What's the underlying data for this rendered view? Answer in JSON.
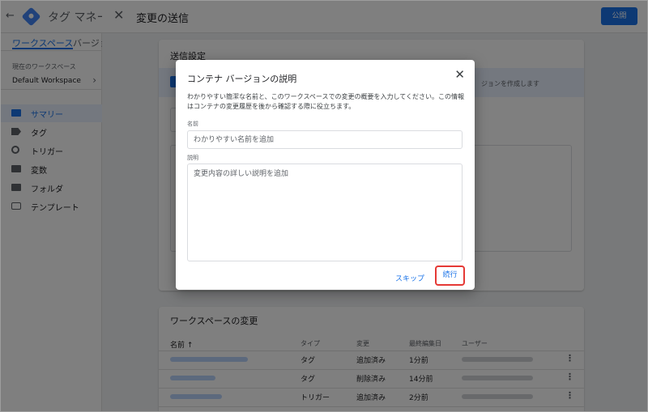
{
  "app": {
    "back_icon": "back-arrow-icon",
    "title": "タグ マネー"
  },
  "left_nav": {
    "tabs": [
      {
        "label": "ワークスペース",
        "active": true
      },
      {
        "label": "バージョ",
        "active": false
      }
    ],
    "workspace_label": "現在のワークスペース",
    "workspace_name": "Default Workspace",
    "items": [
      {
        "label": "サマリー",
        "icon": "folder-icon",
        "selected": true
      },
      {
        "label": "タグ",
        "icon": "tag-icon",
        "selected": false
      },
      {
        "label": "トリガー",
        "icon": "trigger-icon",
        "selected": false
      },
      {
        "label": "変数",
        "icon": "variable-icon",
        "selected": false
      },
      {
        "label": "フォルダ",
        "icon": "folder-icon",
        "selected": false
      },
      {
        "label": "テンプレート",
        "icon": "template-icon",
        "selected": false
      }
    ]
  },
  "panel": {
    "title": "変更の送信",
    "publish_label": "公開",
    "settings_title": "送信設定",
    "create_option_text": "ジョンを作成します",
    "changes_title": "ワークスペースの変更",
    "columns": {
      "name": "名前 ↑",
      "type": "タイプ",
      "change": "変更",
      "last_edited": "最終編集日",
      "user": "ユーザー"
    },
    "rows": [
      {
        "type": "タグ",
        "change": "追加済み",
        "last_edited": "1分前"
      },
      {
        "type": "タグ",
        "change": "削除済み",
        "last_edited": "14分前"
      },
      {
        "type": "トリガー",
        "change": "追加済み",
        "last_edited": "2分前"
      }
    ]
  },
  "dialog": {
    "title": "コンテナ バージョンの説明",
    "description": "わかりやすい簡潔な名前と、このワークスペースでの変更の概要を入力してください。この情報はコンテナの変更履歴を後から確認する際に役立ちます。",
    "name_label": "名前",
    "name_placeholder": "わかりやすい名前を追加",
    "desc_label": "説明",
    "desc_placeholder": "変更内容の詳しい説明を追加",
    "skip_label": "スキップ",
    "continue_label": "続行"
  },
  "colors": {
    "accent": "#1a73e8",
    "highlight": "#e53935",
    "overlay": "rgba(0,0,0,0.5)"
  }
}
